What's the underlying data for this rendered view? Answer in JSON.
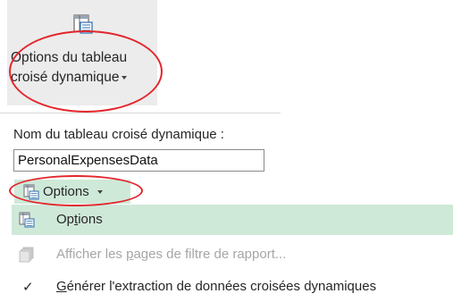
{
  "ribbon": {
    "button_line1": "Options du tableau",
    "button_line2": "croisé dynamique",
    "icon": "pivot-options-icon"
  },
  "pivot_name": {
    "label": "Nom du tableau croisé dynamique :",
    "value": "PersonalExpensesData"
  },
  "options_button": {
    "label": "Options",
    "icon": "pivot-options-icon"
  },
  "menu": {
    "items": [
      {
        "label": "Options",
        "underline": "t",
        "rest_before": "Op",
        "rest_after": "ions",
        "icon": "pivot-options-icon",
        "state": "highlighted"
      },
      {
        "label_before": "Afficher les ",
        "underline": "p",
        "label_after": "ages de filtre de rapport...",
        "icon": "report-pages-icon",
        "state": "disabled"
      },
      {
        "underline": "G",
        "label_after": "énérer l'extraction de données croisées dynamiques",
        "icon": "check-icon",
        "state": "checked"
      }
    ]
  },
  "colors": {
    "highlight": "#cfe9d9",
    "annotation": "#e3262c",
    "ribbon_bg": "#ececec"
  }
}
